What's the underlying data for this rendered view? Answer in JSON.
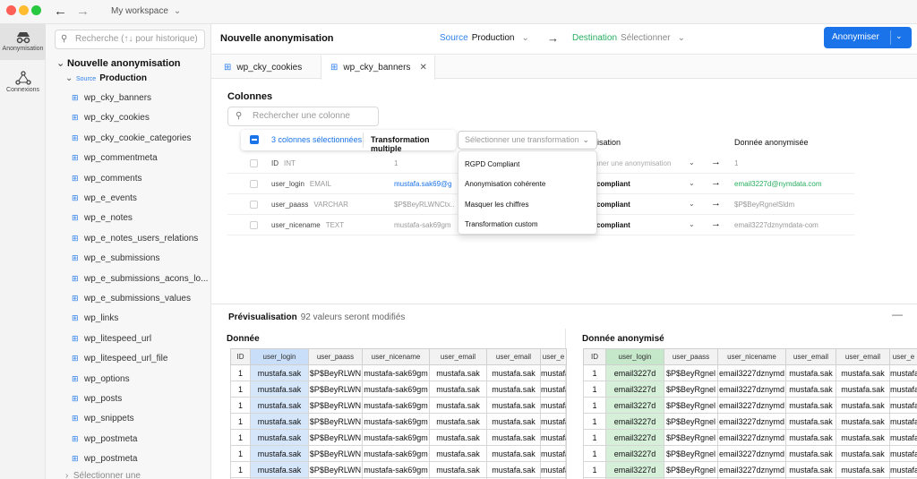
{
  "titlebar": {
    "workspace": "My workspace"
  },
  "rail": [
    {
      "label": "Anonymisation",
      "icon": "incognito-icon",
      "active": true
    },
    {
      "label": "Connexions",
      "icon": "connections-icon",
      "active": false
    }
  ],
  "sidebar": {
    "search_placeholder": "Recherche (↑↓ pour historique)",
    "root": "Nouvelle anonymisation",
    "source_tag": "Source",
    "source_name": "Production",
    "tables": [
      "wp_cky_banners",
      "wp_cky_cookies",
      "wp_cky_cookie_categories",
      "wp_commentmeta",
      "wp_comments",
      "wp_e_events",
      "wp_e_notes",
      "wp_e_notes_users_relations",
      "wp_e_submissions",
      "wp_e_submissions_acons_lo...",
      "wp_e_submissions_values",
      "wp_links",
      "wp_litespeed_url",
      "wp_litespeed_url_file",
      "wp_options",
      "wp_posts",
      "wp_snippets",
      "wp_postmeta",
      "wp_postmeta"
    ],
    "more": "Sélectionner une"
  },
  "header": {
    "title": "Nouvelle anonymisation",
    "source_label": "Source",
    "source_value": "Production",
    "dest_label": "Destination",
    "dest_value": "Sélectionner",
    "primary_button": "Anonymiser"
  },
  "tabs": [
    {
      "label": "wp_cky_cookies",
      "active": false
    },
    {
      "label": "wp_cky_banners",
      "active": true
    }
  ],
  "columns": {
    "title": "Colonnes",
    "search_placeholder": "Rechercher une colonne",
    "bulk_selected": "3 colonnes sélectionnées",
    "bulk_transform": "Transformation multiple",
    "transform_placeholder": "Sélectionner une transformation",
    "header_transform_suffix": "isation",
    "header_anon": "Donnée anonymisée",
    "dropdown_options": [
      "RGPD Compliant",
      "Anonymisation cohérente",
      "Masquer les chiffres",
      "Transformation custom"
    ],
    "rows": [
      {
        "name": "ID",
        "type": "INT",
        "value": "1",
        "transform": "nner une anonymisation",
        "anon": "1",
        "value_link": false,
        "transform_muted": true,
        "anon_green": false
      },
      {
        "name": "user_login",
        "type": "EMAIL",
        "value": "mustafa.sak69@g",
        "transform": "compliant",
        "anon": "email3227d@nymdata.com",
        "value_link": true,
        "transform_muted": false,
        "anon_green": true
      },
      {
        "name": "user_paass",
        "type": "VARCHAR",
        "value": "$P$BeyRLWNCtx...",
        "transform": "compliant",
        "anon": "$P$BeyRgnelSldm",
        "value_link": false,
        "transform_muted": false,
        "anon_green": false
      },
      {
        "name": "user_nicename",
        "type": "TEXT",
        "value": "mustafa-sak69gm",
        "transform": "compliant",
        "anon": "email3227dznymdata-com",
        "value_link": false,
        "transform_muted": false,
        "anon_green": false
      }
    ]
  },
  "preview": {
    "title": "Prévisualisation",
    "count": "92 valeurs seront modifiés",
    "left_title": "Donnée",
    "right_title": "Donnée anonymisé",
    "left_headers": [
      "ID",
      "user_login",
      "user_paass",
      "user_nicename",
      "user_email",
      "user_email",
      "user_e"
    ],
    "right_headers": [
      "ID",
      "user_login",
      "user_paass",
      "user_nicename",
      "user_email",
      "user_email",
      "user_e"
    ],
    "left_rows": [
      [
        "1",
        "mustafa.sak",
        "$P$BeyRLWN",
        "mustafa-sak69gm",
        "mustafa.sak",
        "mustafa.sak",
        "mustafa"
      ],
      [
        "1",
        "mustafa.sak",
        "$P$BeyRLWN",
        "mustafa-sak69gm",
        "mustafa.sak",
        "mustafa.sak",
        "mustafa"
      ],
      [
        "1",
        "mustafa.sak",
        "$P$BeyRLWN",
        "mustafa-sak69gm",
        "mustafa.sak",
        "mustafa.sak",
        "mustafa"
      ],
      [
        "1",
        "mustafa.sak",
        "$P$BeyRLWN",
        "mustafa-sak69gm",
        "mustafa.sak",
        "mustafa.sak",
        "mustafa"
      ],
      [
        "1",
        "mustafa.sak",
        "$P$BeyRLWN",
        "mustafa-sak69gm",
        "mustafa.sak",
        "mustafa.sak",
        "mustafa"
      ],
      [
        "1",
        "mustafa.sak",
        "$P$BeyRLWN",
        "mustafa-sak69gm",
        "mustafa.sak",
        "mustafa.sak",
        "mustafa"
      ],
      [
        "1",
        "mustafa.sak",
        "$P$BeyRLWN",
        "mustafa-sak69gm",
        "mustafa.sak",
        "mustafa.sak",
        "mustafa"
      ],
      [
        "1",
        "mustafa.sak",
        "$P$BeyRLWN",
        "mustafa-sak69gm",
        "mustafa.sak",
        "mustafa.sak",
        "mustafa"
      ]
    ],
    "right_rows": [
      [
        "1",
        "email3227d",
        "$P$BeyRgnel",
        "email3227dznymd",
        "mustafa.sak",
        "mustafa.sak",
        "mustafa"
      ],
      [
        "1",
        "email3227d",
        "$P$BeyRgnel",
        "email3227dznymd",
        "mustafa.sak",
        "mustafa.sak",
        "mustafa"
      ],
      [
        "1",
        "email3227d",
        "$P$BeyRgnel",
        "email3227dznymd",
        "mustafa.sak",
        "mustafa.sak",
        "mustafa"
      ],
      [
        "1",
        "email3227d",
        "$P$BeyRgnel",
        "email3227dznymd",
        "mustafa.sak",
        "mustafa.sak",
        "mustafa"
      ],
      [
        "1",
        "email3227d",
        "$P$BeyRgnel",
        "email3227dznymd",
        "mustafa.sak",
        "mustafa.sak",
        "mustafa"
      ],
      [
        "1",
        "email3227d",
        "$P$BeyRgnel",
        "email3227dznymd",
        "mustafa.sak",
        "mustafa.sak",
        "mustafa"
      ],
      [
        "1",
        "email3227d",
        "$P$BeyRgnel",
        "email3227dznymd",
        "mustafa.sak",
        "mustafa.sak",
        "mustafa"
      ],
      [
        "1",
        "email3227d",
        "$P$BeyRgnel",
        "email3227dznymd",
        "mustafa.sak",
        "mustafa.sak",
        "mustafa"
      ]
    ]
  },
  "colors": {
    "accent": "#1a73e8",
    "source": "#2f80ed",
    "destination": "#27ae60",
    "highlight_source": "#d5e6fb",
    "highlight_anon": "#d6efd9"
  }
}
